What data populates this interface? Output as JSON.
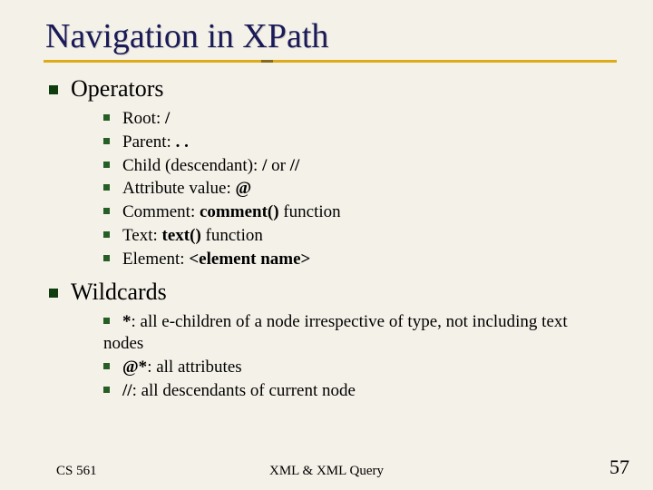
{
  "title": "Navigation in XPath",
  "sections": [
    {
      "heading": "Operators",
      "items": [
        {
          "prefix": "Root: ",
          "bold": "/",
          "suffix": ""
        },
        {
          "prefix": "Parent: ",
          "bold": ". .",
          "suffix": ""
        },
        {
          "prefix": "Child (descendant): ",
          "bold": "/",
          "mid": " or ",
          "bold2": "//",
          "suffix": ""
        },
        {
          "prefix": "Attribute value: ",
          "bold": "@",
          "suffix": ""
        },
        {
          "prefix": "Comment: ",
          "bold": "comment()",
          "suffix": " function"
        },
        {
          "prefix": "Text: ",
          "bold": "text()",
          "suffix": " function"
        },
        {
          "prefix": "Element: ",
          "bold": "<element name>",
          "suffix": ""
        }
      ]
    },
    {
      "heading": "Wildcards",
      "items": [
        {
          "bold": "*",
          "prefix": "",
          "suffix": ": all e-children of a node irrespective of type, not including text nodes"
        },
        {
          "bold": "@*",
          "prefix": "",
          "suffix": ": all attributes"
        },
        {
          "bold": "//",
          "prefix": "",
          "suffix": ": all descendants of current node"
        }
      ]
    }
  ],
  "footer": {
    "left": "CS 561",
    "center": "XML & XML Query",
    "right": "57"
  }
}
